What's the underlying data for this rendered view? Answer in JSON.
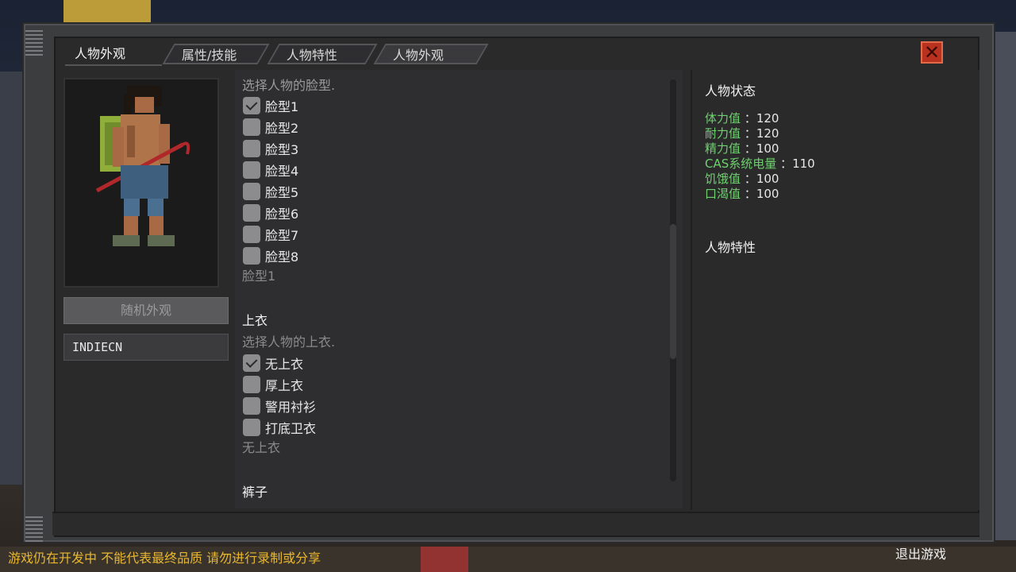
{
  "window": {
    "title": "人物外观",
    "tabs": [
      "属性/技能",
      "人物特性",
      "人物外观"
    ]
  },
  "left": {
    "random_button": "随机外观",
    "name_value": "INDIECN"
  },
  "face": {
    "prompt": "选择人物的脸型.",
    "options": [
      "脸型1",
      "脸型2",
      "脸型3",
      "脸型4",
      "脸型5",
      "脸型6",
      "脸型7",
      "脸型8"
    ],
    "checked_index": 0,
    "selected": "脸型1"
  },
  "top": {
    "heading": "上衣",
    "prompt": "选择人物的上衣.",
    "options": [
      "无上衣",
      "厚上衣",
      "警用衬衫",
      "打底卫衣"
    ],
    "checked_index": 0,
    "selected": "无上衣"
  },
  "pants": {
    "heading": "裤子"
  },
  "status": {
    "heading": "人物状态",
    "stats": [
      {
        "label": "体力值",
        "value": "120"
      },
      {
        "label": "耐力值",
        "value": "120"
      },
      {
        "label": "精力值",
        "value": "100"
      },
      {
        "label": "CAS系统电量",
        "value": "110"
      },
      {
        "label": "饥饿值",
        "value": "100"
      },
      {
        "label": "口渴值",
        "value": "100"
      }
    ],
    "separator": "：",
    "traits_heading": "人物特性"
  },
  "footer": {
    "warning": "游戏仍在开发中 不能代表最终品质 请勿进行录制或分享",
    "quit": "退出游戏"
  },
  "colors": {
    "stat_label": "#6fd06f",
    "warning": "#e8b72f",
    "close": "#b8321f"
  },
  "icons": {
    "close": "close-x-icon",
    "check": "checkmark-icon"
  }
}
